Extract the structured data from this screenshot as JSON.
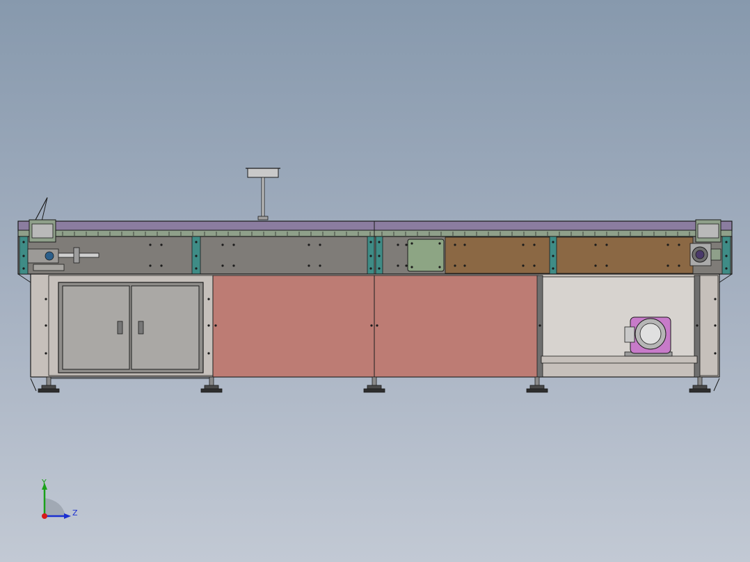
{
  "viewport": {
    "background_top": "#8799ad",
    "background_bottom": "#c2c9d4"
  },
  "model": {
    "name": "conveyor-assembly",
    "colors": {
      "edge": "#1b1b1b",
      "top_rail": "#8b7da0",
      "grey_plate": "#7f7c78",
      "brown_plate": "#8b6844",
      "teal_bracket": "#3f8c86",
      "green_plate": "#8da584",
      "salmon_panel": "#bd7c74",
      "frame": "#c6c0bb",
      "door": "#aaa8a5",
      "motor": "#c77bc9",
      "base": "#3a3a3a"
    }
  },
  "triad": {
    "y_label": "Y",
    "z_label": "Z",
    "x_color": "#d61a1a",
    "y_color": "#1aa11a",
    "z_color": "#1a2fd0"
  }
}
